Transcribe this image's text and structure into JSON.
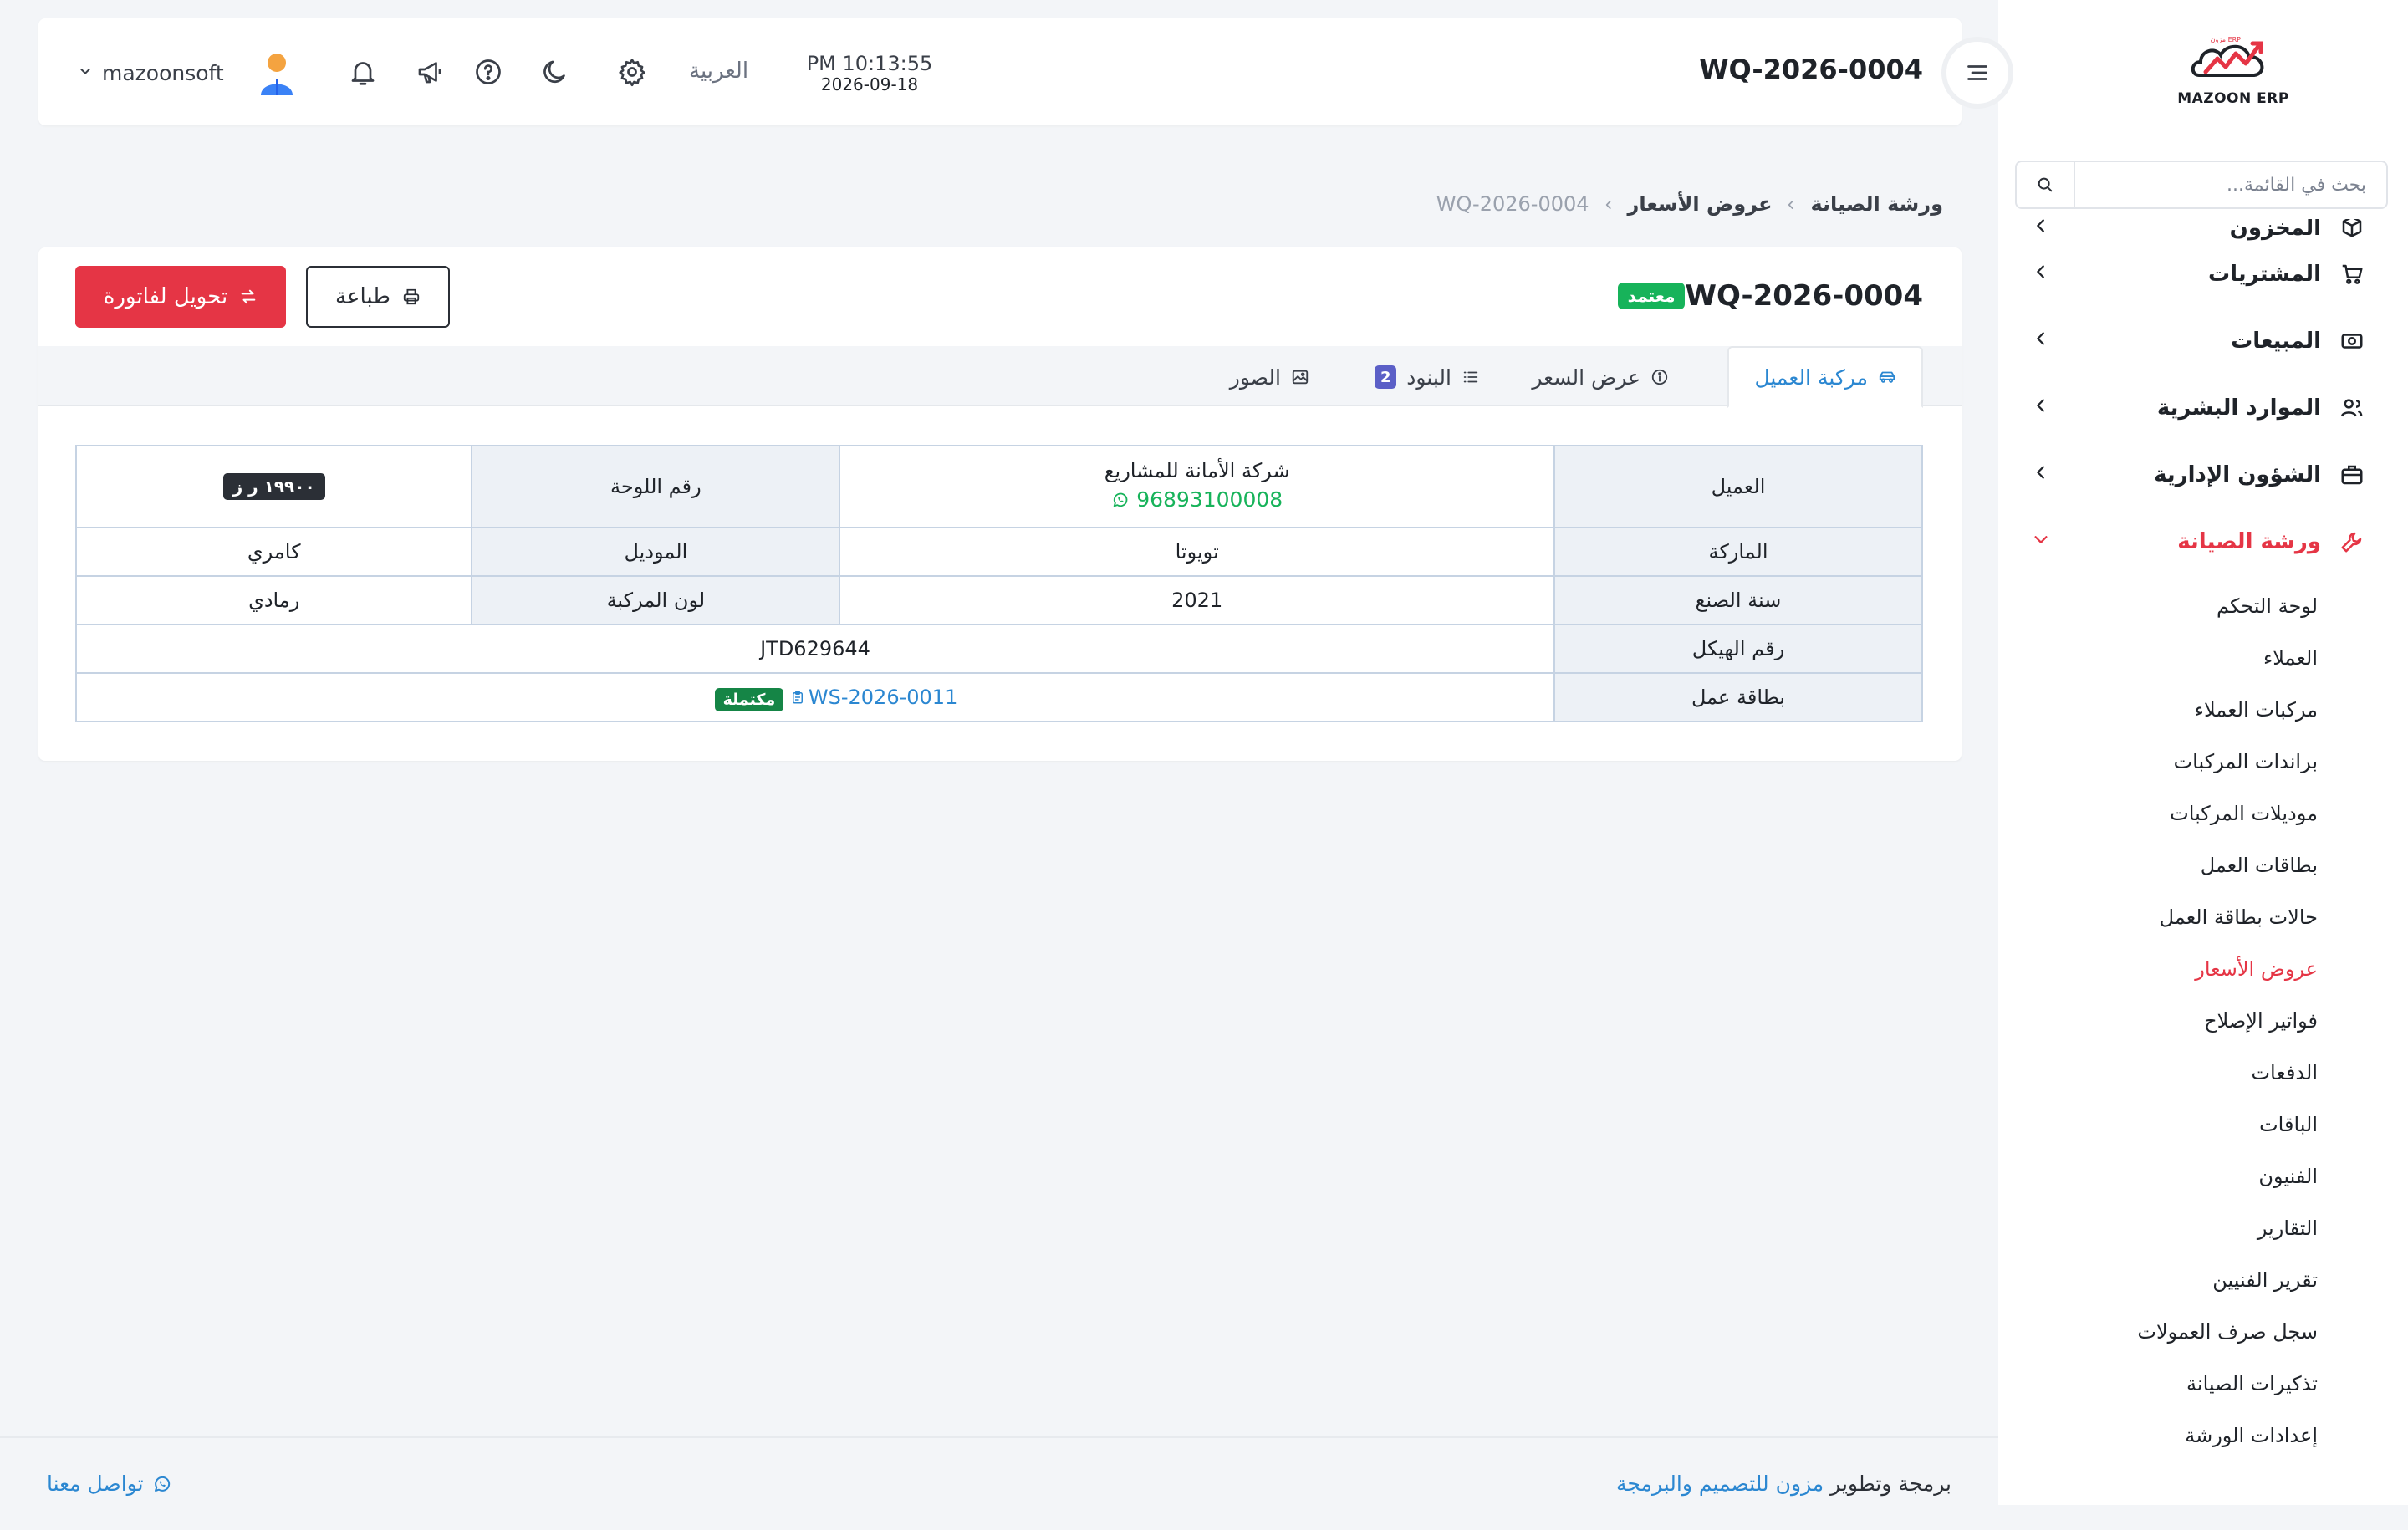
{
  "app": {
    "logo_text": "MAZOON ERP",
    "logo_tag": "ERP مزون",
    "doc_number": "WQ-2026-0004"
  },
  "sidebar": {
    "search_placeholder": "بحث في القائمة...",
    "items": [
      {
        "label": "المخزون",
        "icon": "box-icon"
      },
      {
        "label": "المشتريات",
        "icon": "cart-icon"
      },
      {
        "label": "المبيعات",
        "icon": "cash-icon"
      },
      {
        "label": "الموارد البشرية",
        "icon": "users-icon"
      },
      {
        "label": "الشؤون الإدارية",
        "icon": "briefcase-icon"
      },
      {
        "label": "ورشة الصيانة",
        "icon": "wrench-icon",
        "active": true
      }
    ],
    "sub_items": [
      {
        "label": "لوحة التحكم"
      },
      {
        "label": "العملاء"
      },
      {
        "label": "مركبات العملاء"
      },
      {
        "label": "براندات المركبات"
      },
      {
        "label": "موديلات المركبات"
      },
      {
        "label": "بطاقات العمل"
      },
      {
        "label": "حالات بطاقة العمل"
      },
      {
        "label": "عروض الأسعار",
        "active": true
      },
      {
        "label": "فواتير الإصلاح"
      },
      {
        "label": "الدفعات"
      },
      {
        "label": "الباقات"
      },
      {
        "label": "الفنيون"
      },
      {
        "label": "التقارير"
      },
      {
        "label": "تقرير الفنيين"
      },
      {
        "label": "سجل صرف العمولات"
      },
      {
        "label": "تذكيرات الصيانة"
      },
      {
        "label": "إعدادات الورشة"
      }
    ]
  },
  "header": {
    "title": "WQ-2026-0004",
    "time": "PM 10:13:55",
    "date": "2026-09-18",
    "language": "العربية",
    "username": "mazoonsoft",
    "icons": [
      "gear-icon",
      "moon-icon",
      "help-icon",
      "megaphone-icon",
      "bell-icon"
    ]
  },
  "breadcrumb": {
    "items": [
      "ورشة الصيانة",
      "عروض الأسعار",
      "WQ-2026-0004"
    ]
  },
  "card": {
    "title": "WQ-2026-0004",
    "status": "معتمد",
    "convert_label": "تحويل لفاتورة",
    "print_label": "طباعة",
    "tabs": [
      {
        "label": "مركبة العميل",
        "icon": "car-icon",
        "active": true
      },
      {
        "label": "عرض السعر",
        "icon": "info-icon"
      },
      {
        "label": "البنود",
        "icon": "list-icon",
        "count": "2"
      },
      {
        "label": "الصور",
        "icon": "image-icon"
      }
    ]
  },
  "vehicle": {
    "customer_label": "العميل",
    "customer_name": "شركة الأمانة للمشاريع",
    "customer_phone": "96893100008",
    "plate_label": "رقم اللوحة",
    "plate_value": "١٩٩٠٠ ر ز",
    "brand_label": "الماركة",
    "brand_value": "تويوتا",
    "model_label": "الموديل",
    "model_value": "كامري",
    "year_label": "سنة الصنع",
    "year_value": "2021",
    "color_label": "لون المركبة",
    "color_value": "رمادي",
    "vin_label": "رقم الهيكل",
    "vin_value": "JTD629644",
    "jobcard_label": "بطاقة عمل",
    "jobcard_value": "WS-2026-0011",
    "jobcard_status": "مكتملة"
  },
  "footer": {
    "credit_prefix": "برمجة وتطوير",
    "credit_brand": "مزون للتصميم والبرمجة",
    "contact": "تواصل معنا"
  },
  "colors": {
    "accent_red": "#e53545",
    "link_blue": "#2b87d1",
    "success_green": "#17b35a",
    "dark_green": "#158546",
    "indigo": "#5b5fc7"
  }
}
